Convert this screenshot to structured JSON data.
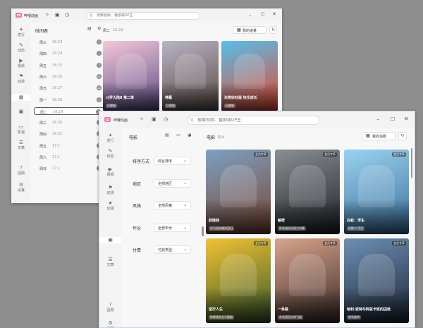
{
  "app": {
    "name": "哔哩动画",
    "logo_color": "#fb7299"
  },
  "search": {
    "placeholder": "搜索视频、番剧或UP主"
  },
  "back_window": {
    "nav": [
      {
        "label": "发行",
        "icon": "sparkle"
      },
      {
        "label": "动态",
        "icon": "chat"
      },
      {
        "label": "视频",
        "icon": "play"
      },
      {
        "label": "动漫",
        "icon": "pin"
      },
      {
        "label": "",
        "icon": "grid"
      },
      {
        "label": "",
        "icon": "film"
      },
      {
        "label": "影视",
        "icon": "tv"
      },
      {
        "label": "文章",
        "icon": "doc"
      },
      {
        "label": "回顾",
        "icon": "help"
      },
      {
        "label": "设置",
        "icon": "gear"
      }
    ],
    "timeline_title": "时间表",
    "timeline": [
      {
        "day": "周三",
        "time": "16:23",
        "count": "1"
      },
      {
        "day": "周四",
        "time": "16:24",
        "count": "1"
      },
      {
        "day": "周五",
        "time": "16:25",
        "count": "2"
      },
      {
        "day": "周六",
        "time": "16:26",
        "count": "11"
      },
      {
        "day": "周日",
        "time": "16:27",
        "count": "12"
      },
      {
        "day": "周一",
        "time": "16:28",
        "count": "3"
      },
      {
        "day": "周二",
        "time": "16:29",
        "count": "3"
      },
      {
        "day": "周三",
        "time": "16:30",
        "count": "2"
      },
      {
        "day": "周四",
        "time": "16:31",
        "count": "2"
      },
      {
        "day": "周五",
        "time": "17:1",
        "count": "1"
      },
      {
        "day": "周六",
        "time": "17:1",
        "count": "1"
      },
      {
        "day": "周日",
        "time": "17:1",
        "count": "1"
      }
    ],
    "header_day": "周二",
    "header_time": "16:29",
    "my_follow": "我的追番",
    "cards": [
      {
        "title": "斗罗大陆Ⅱ 第二季",
        "sub": "已更新",
        "c1": "#f5c8d8",
        "c2": "#5a4a86"
      },
      {
        "title": "神墓",
        "sub": "已更新",
        "c1": "#b9b4c6",
        "c2": "#584a43"
      },
      {
        "title": "米奇妙妙屋 快乐成长",
        "sub": "已更新",
        "c1": "#54c0ea",
        "c2": "#e8472f"
      }
    ]
  },
  "front_window": {
    "nav": [
      {
        "label": "发行",
        "icon": "sparkle"
      },
      {
        "label": "动态",
        "icon": "chat"
      },
      {
        "label": "视频",
        "icon": "play"
      },
      {
        "label": "动漫",
        "icon": "pin"
      },
      {
        "label": "动漫",
        "icon": "star"
      },
      {
        "label": "",
        "icon": "film"
      },
      {
        "label": "文章",
        "icon": "doc"
      },
      {
        "label": "回顾",
        "icon": "help"
      },
      {
        "label": "设置",
        "icon": "gear"
      }
    ],
    "section_title": "电影",
    "header_title": "电影",
    "header_sub": "影片",
    "my_follow": "我的追剧",
    "filters": [
      {
        "label": "排序方式",
        "value": "综合排序"
      },
      {
        "label": "地区",
        "value": "全部地区"
      },
      {
        "label": "风格",
        "value": "全部风格"
      },
      {
        "label": "年份",
        "value": "全部年份"
      },
      {
        "label": "付费",
        "value": "付费类型"
      }
    ],
    "cards": [
      {
        "title": "抓娃娃",
        "sub": "沈马组合爆笑回归",
        "badge": "会员专享",
        "c1": "#7da0c2",
        "c2": "#7a4634"
      },
      {
        "title": "解密",
        "sub": "陈思诚拍出智力风暴",
        "badge": "会员专享",
        "c1": "#8a8f94",
        "c2": "#1f2226"
      },
      {
        "title": "白蛇：浮生",
        "sub": "白蛇二 浮生",
        "badge": "会员专享",
        "c1": "#9ad3f0",
        "c2": "#3c6f9c"
      },
      {
        "title": "逆行人生",
        "sub": "徐峥演实主义喜剧",
        "badge": "会员专享",
        "c1": "#f1c233",
        "c2": "#3a5a2a"
      },
      {
        "title": "一条路",
        "sub": "东北演员从鸡飞起",
        "badge": "会员专享",
        "c1": "#d8a48c",
        "c2": "#3c2b27"
      },
      {
        "title": "哈利·波特与阿兹卡班的囚徒",
        "sub": "哈利波特",
        "badge": "会员专享",
        "c1": "#6d8fb4",
        "c2": "#1d2836"
      }
    ]
  }
}
